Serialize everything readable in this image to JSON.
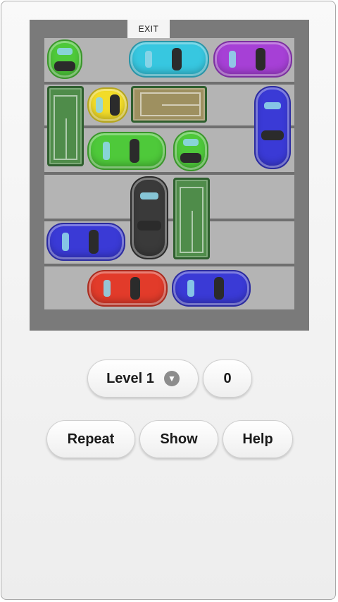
{
  "board": {
    "exit_label": "EXIT",
    "lot_color": "#b4b4b4",
    "border_color": "#7a7a7a"
  },
  "pieces": [
    {
      "name": "green-car-top-left",
      "kind": "car",
      "orient": "v",
      "color": "#4ec93a"
    },
    {
      "name": "cyan-car",
      "kind": "car",
      "orient": "h",
      "color": "#37c7e0"
    },
    {
      "name": "purple-car",
      "kind": "car",
      "orient": "h",
      "color": "#a640d6"
    },
    {
      "name": "green-truck-left",
      "kind": "truck",
      "orient": "v",
      "color": "#4f8c4a"
    },
    {
      "name": "yellow-car",
      "kind": "car",
      "orient": "h",
      "color": "#f2dc29"
    },
    {
      "name": "tan-truck",
      "kind": "truck",
      "orient": "h",
      "color": "#9e9060"
    },
    {
      "name": "blue-car-right",
      "kind": "car",
      "orient": "v",
      "color": "#3a3ad6"
    },
    {
      "name": "green-car-middle",
      "kind": "car",
      "orient": "h",
      "color": "#4ec93a"
    },
    {
      "name": "green-car-small",
      "kind": "car",
      "orient": "v",
      "color": "#4ec93a"
    },
    {
      "name": "black-car",
      "kind": "car",
      "orient": "v",
      "color": "#3a3a3a"
    },
    {
      "name": "green-truck-middle",
      "kind": "truck",
      "orient": "v",
      "color": "#4f8c4a"
    },
    {
      "name": "blue-car-left",
      "kind": "car",
      "orient": "h",
      "color": "#3a3ad6"
    },
    {
      "name": "red-car",
      "kind": "car",
      "orient": "h",
      "color": "#e23b2a"
    },
    {
      "name": "blue-car-bottom",
      "kind": "car",
      "orient": "h",
      "color": "#3a3ad6"
    }
  ],
  "controls": {
    "level_label": "Level 1",
    "move_count": "0",
    "repeat_label": "Repeat",
    "show_label": "Show",
    "help_label": "Help"
  }
}
